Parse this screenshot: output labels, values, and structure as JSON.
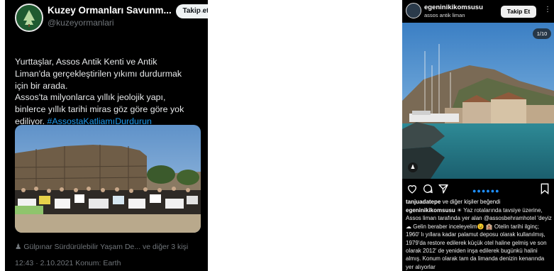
{
  "tweet": {
    "author_name": "Kuzey Ormanları Savunm...",
    "author_handle": "@kuzeyormanlari",
    "follow_label": "Takip et",
    "more": "···",
    "text": "Yurttaşlar, Assos Antik Kenti ve Antik\nLiman'da gerçekleştirilen yıkımı durdurmak\niçin bir arada.\nAssos'ta milyonlarca yıllık jeolojik yapı,\nbinlerce yıllık tarihi miras göz göre göre yok\nediliyor. ",
    "hashtag": "#AssostaKatliamıDurdurun",
    "tag_line": "Gülpınar Sürdürülebilir Yaşam De... ve diğer 3 kişi",
    "meta_line": "12:43 · 2.10.2021 Konum: Earth"
  },
  "instagram": {
    "username": "egeninikikomsusu",
    "location": "assos antik liman",
    "follow_label": "Takip Et",
    "more": "⋮",
    "counter": "1/10",
    "likes_user": "tanjuadatepe",
    "likes_rest": " ve diğer kişiler beğendi",
    "caption_user": "egeninikikomsusu",
    "caption_text": " ☀ Yaz rotalarında tavsiye üzerine, Assos liman tarafında yer alan @assosbehramhotel 'deyiz ☁ Gelin beraber inceleyelim😉 🏨 Otelin tarihi ilginç; 1960' lı yıllara kadar palamut deposu olarak kullanılmış, 1979'da restore edilerek küçük otel haline gelmiş ve son olarak 2012' de yeniden inşa edilerek bugünkü halini almış. Konum olarak tam da limanda denizin kenarında yer alıyorlar",
    "colors": {
      "accent_dots": "#1e90ff"
    }
  }
}
